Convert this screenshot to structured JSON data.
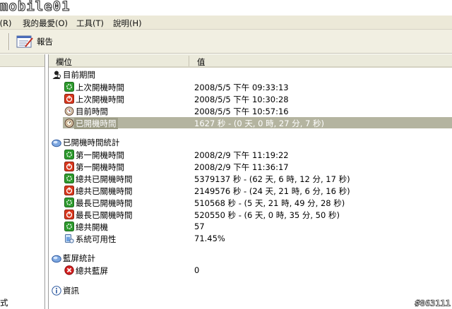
{
  "title_bar": {
    "logo_text": "mobile01"
  },
  "menu": {
    "items": [
      {
        "label": "像(R)"
      },
      {
        "label": "我的最愛(O)"
      },
      {
        "label": "工具(T)"
      },
      {
        "label": "說明(H)"
      }
    ]
  },
  "toolbar": {
    "report_label": "報告",
    "report_icon": "report-icon"
  },
  "left_pane": {
    "partial_text": "式"
  },
  "columns": {
    "field": "欄位",
    "value": "值"
  },
  "groups": [
    {
      "title": "目前期間",
      "icon": "user-icon",
      "rows": [
        {
          "label": "上次開機時間",
          "value": "2008/5/5 下午 09:33:13",
          "icon": "power-on-icon"
        },
        {
          "label": "上次開機時間",
          "value": "2008/5/5 下午 10:30:28",
          "icon": "power-off-icon"
        },
        {
          "label": "目前時間",
          "value": "2008/5/5 下午 10:57:16",
          "icon": "clock-icon"
        },
        {
          "label": "已開機時間",
          "value": "1627 秒 - (0 天, 0 時, 27 分, 7 秒)",
          "icon": "uptime-icon",
          "selected": true
        }
      ]
    },
    {
      "title": "已開機時間統計",
      "icon": "stats-icon",
      "rows": [
        {
          "label": "第一開機時間",
          "value": "2008/2/9 下午 11:19:22",
          "icon": "power-on-icon"
        },
        {
          "label": "第一開機時間",
          "value": "2008/2/9 下午 11:36:17",
          "icon": "power-off-icon"
        },
        {
          "label": "總共已開機時間",
          "value": "5379137 秒 - (62 天, 6 時, 12 分, 17 秒)",
          "icon": "power-on-icon"
        },
        {
          "label": "總共已關機時間",
          "value": "2149576 秒 - (24 天, 21 時, 6 分, 16 秒)",
          "icon": "power-off-icon"
        },
        {
          "label": "最長已開機時間",
          "value": "510568 秒 - (5 天, 21 時, 49 分, 28 秒)",
          "icon": "power-on-icon"
        },
        {
          "label": "最長已關機時間",
          "value": "520550 秒 - (6 天, 0 時, 35 分, 50 秒)",
          "icon": "power-off-icon"
        },
        {
          "label": "總共開機",
          "value": "57",
          "icon": "power-on-icon"
        },
        {
          "label": "系統可用性",
          "value": "71.45%",
          "icon": "availability-icon"
        }
      ]
    },
    {
      "title": "藍屏統計",
      "icon": "stats-icon",
      "rows": [
        {
          "label": "總共藍屏",
          "value": "0",
          "icon": "error-icon"
        }
      ]
    },
    {
      "title": "資訊",
      "icon": "info-icon",
      "rows": []
    }
  ],
  "watermark": "#863111",
  "colors": {
    "menu_bg": "#ece9d8",
    "toolbar_bg": "#f1efe2",
    "header_bg": "#ebeadb",
    "selected_row": "#b4b4a0",
    "power_on": "#2e9a2e",
    "power_off": "#d9381e"
  }
}
